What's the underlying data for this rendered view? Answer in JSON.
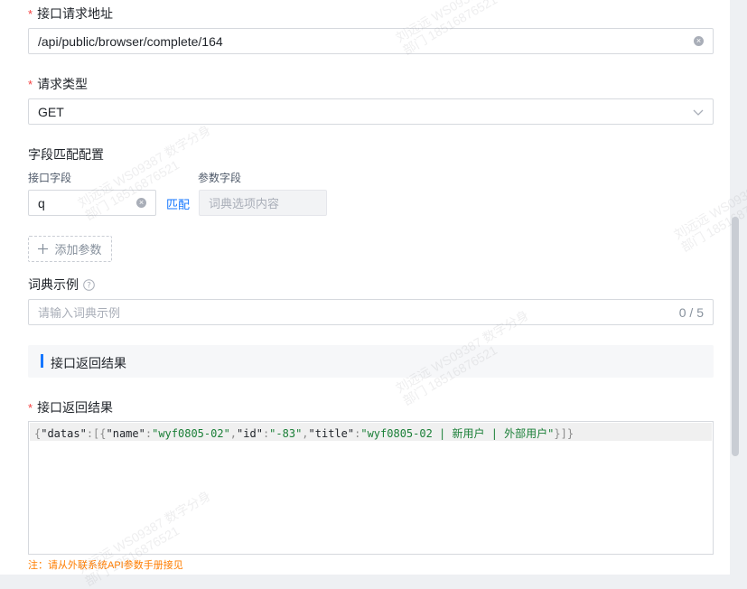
{
  "form": {
    "url_field": {
      "required_mark": "*",
      "label": "接口请求地址",
      "value": "/api/public/browser/complete/164"
    },
    "request_type": {
      "required_mark": "*",
      "label": "请求类型",
      "value": "GET"
    },
    "field_mapping": {
      "label": "字段匹配配置",
      "interface_field_label": "接口字段",
      "param_field_label": "参数字段",
      "interface_field_value": "q",
      "match_link": "匹配",
      "param_field_placeholder": "词典选项内容"
    },
    "add_param_button": {
      "icon": "plus-icon",
      "label": "添加参数"
    },
    "dict_example": {
      "label": "词典示例",
      "help_icon": "question-circle-icon",
      "placeholder": "请输入词典示例",
      "counter": "0 / 5"
    },
    "return_section": {
      "title": "接口返回结果"
    },
    "return_result": {
      "required_mark": "*",
      "label": "接口返回结果",
      "json_tokens": {
        "open": "{",
        "k_datas": "\"datas\"",
        "colon1": ":[{",
        "k_name": "\"name\"",
        "colon2": ":",
        "v_name": "\"wyf0805-02\"",
        "comma1": ",",
        "k_id": "\"id\"",
        "colon3": ":",
        "v_id": "\"-83\"",
        "comma2": ",",
        "k_title": "\"title\"",
        "colon4": ":",
        "v_title": "\"wyf0805-02 | 新用户 | 外部用户\"",
        "close": "}]}"
      }
    },
    "footer_note": "注：请从外联系统API参数手册接见"
  },
  "watermark": {
    "name_id": "刘远远 WS09387 数字分身",
    "dept_phone": "部门 18516876521"
  },
  "colors": {
    "accent": "#1677ff",
    "required": "#f53f3f",
    "json_string": "#1a7f37",
    "note": "#ff7d00"
  }
}
